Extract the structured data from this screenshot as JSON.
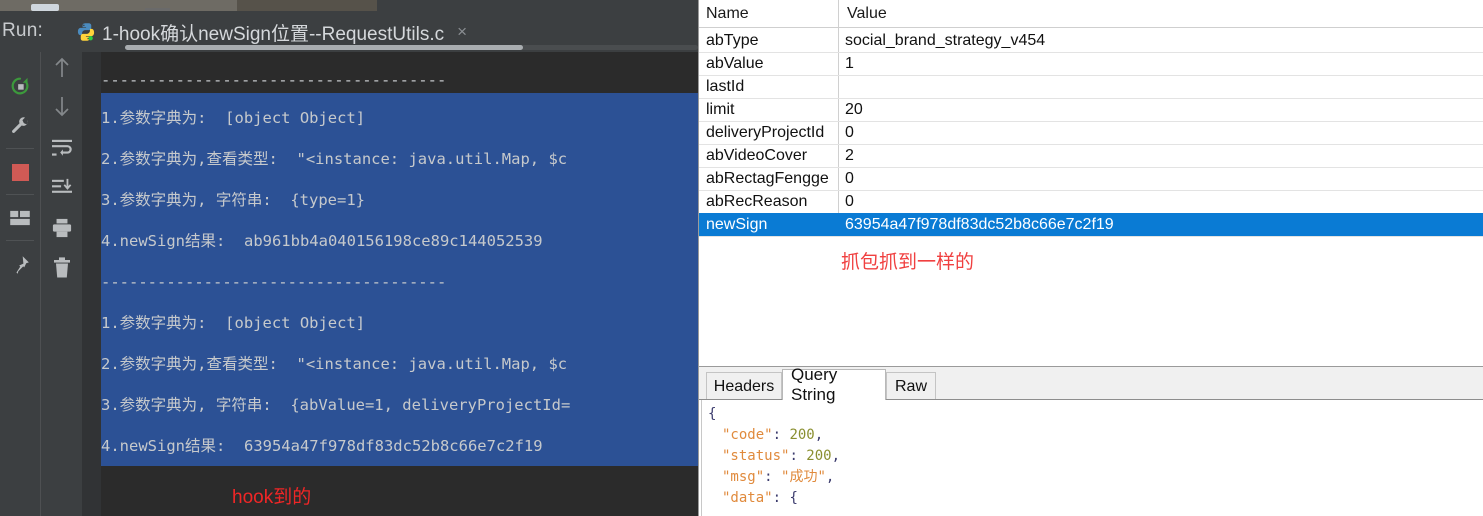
{
  "ide": {
    "run_label": "Run:",
    "tab": {
      "icon": "python-icon",
      "title": "1-hook确认newSign位置--RequestUtils.c",
      "close": "×"
    },
    "toolbar_left": [
      {
        "name": "rerun-icon",
        "label": "Rerun"
      },
      {
        "name": "wrench-icon",
        "label": "Edit Configuration"
      },
      {
        "name": "stop-icon",
        "label": "Stop"
      },
      {
        "name": "layout-icon",
        "label": "Layout"
      },
      {
        "name": "pin-icon",
        "label": "Pin Tab"
      }
    ],
    "toolbar_right": [
      {
        "name": "arrow-up-icon",
        "label": "Up"
      },
      {
        "name": "arrow-down-icon",
        "label": "Down"
      },
      {
        "name": "soft-wrap-icon",
        "label": "Soft-Wrap"
      },
      {
        "name": "scroll-to-end-icon",
        "label": "Scroll to End"
      },
      {
        "name": "print-icon",
        "label": "Print"
      },
      {
        "name": "trash-icon",
        "label": "Clear All"
      }
    ],
    "console_lines": [
      "-------------------------------------",
      "1.参数字典为:  [object Object]",
      "2.参数字典为,查看类型:  \"<instance: java.util.Map, $c",
      "3.参数字典为, 字符串:  {type=1}",
      "4.newSign结果:  ab961bb4a040156198ce89c144052539",
      "-------------------------------------",
      "1.参数字典为:  [object Object]",
      "2.参数字典为,查看类型:  \"<instance: java.util.Map, $c",
      "3.参数字典为, 字符串:  {abValue=1, deliveryProjectId=",
      "4.newSign结果:  63954a47f978df83dc52b8c66e7c2f19"
    ],
    "annotation": "hook到的",
    "annotation_color": "#f02626",
    "selection_color": "#2c5195"
  },
  "inspector": {
    "columns": [
      "Name",
      "Value"
    ],
    "rows": [
      {
        "name": "abType",
        "value": "social_brand_strategy_v454",
        "selected": false
      },
      {
        "name": "abValue",
        "value": "1",
        "selected": false
      },
      {
        "name": "lastId",
        "value": "",
        "selected": false
      },
      {
        "name": "limit",
        "value": "20",
        "selected": false
      },
      {
        "name": "deliveryProjectId",
        "value": "0",
        "selected": false
      },
      {
        "name": "abVideoCover",
        "value": "2",
        "selected": false
      },
      {
        "name": "abRectagFengge",
        "value": "0",
        "selected": false
      },
      {
        "name": "abRecReason",
        "value": "0",
        "selected": false
      },
      {
        "name": "newSign",
        "value": "63954a47f978df83dc52b8c66e7c2f19",
        "selected": true
      }
    ],
    "annotation": "抓包抓到一样的",
    "annotation_color": "#f04040",
    "selected_row_color": "#0a7bd4",
    "tabs": [
      {
        "label": "Headers",
        "active": false
      },
      {
        "label": "Query String",
        "active": true
      },
      {
        "label": "Raw",
        "active": false
      }
    ],
    "json_lines": [
      {
        "indent": 0,
        "parts": [
          {
            "t": "{",
            "c": "jpun"
          }
        ]
      },
      {
        "indent": 1,
        "parts": [
          {
            "t": "\"code\"",
            "c": "jkey"
          },
          {
            "t": ": ",
            "c": "jpun"
          },
          {
            "t": "200",
            "c": "jnum"
          },
          {
            "t": ",",
            "c": "jpun"
          }
        ]
      },
      {
        "indent": 1,
        "parts": [
          {
            "t": "\"status\"",
            "c": "jkey"
          },
          {
            "t": ": ",
            "c": "jpun"
          },
          {
            "t": "200",
            "c": "jnum"
          },
          {
            "t": ",",
            "c": "jpun"
          }
        ]
      },
      {
        "indent": 1,
        "parts": [
          {
            "t": "\"msg\"",
            "c": "jkey"
          },
          {
            "t": ": ",
            "c": "jpun"
          },
          {
            "t": "\"成功\"",
            "c": "jstr"
          },
          {
            "t": ",",
            "c": "jpun"
          }
        ]
      },
      {
        "indent": 1,
        "parts": [
          {
            "t": "\"data\"",
            "c": "jkey"
          },
          {
            "t": ": ",
            "c": "jpun"
          },
          {
            "t": "{",
            "c": "jpun"
          }
        ]
      }
    ]
  }
}
